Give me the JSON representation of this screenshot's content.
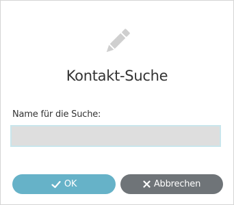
{
  "dialog": {
    "icon": "pencil-icon",
    "title": "Kontakt-Suche"
  },
  "form": {
    "label": "Name für die Suche:",
    "input_value": "",
    "input_placeholder": ""
  },
  "buttons": {
    "ok": {
      "icon": "check-icon",
      "label": "OK"
    },
    "cancel": {
      "icon": "close-icon",
      "label": "Abbrechen"
    }
  },
  "colors": {
    "icon": "#cfcfcf",
    "ok_button": "#66b2c8",
    "cancel_button": "#6f7478",
    "input_background": "#dedede",
    "input_border": "#c9e6ec",
    "text": "#333333"
  }
}
